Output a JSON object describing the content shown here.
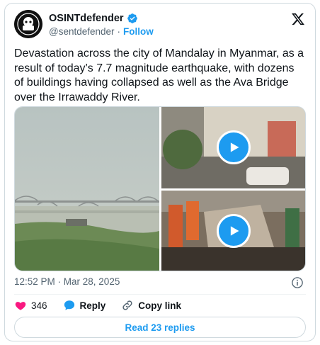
{
  "author": {
    "name": "OSINTdefender",
    "handle": "@sentdefender",
    "separator": "·",
    "follow_label": "Follow"
  },
  "tweet": {
    "text": "Devastation across the city of Mandalay in Myanmar, as a result of today’s 7.7 magnitude earthquake, with dozens of buildings having collapsed as well as the Ava Bridge over the Irrawaddy River.",
    "timestamp": "12:52 PM · Mar 28, 2025"
  },
  "actions": {
    "likes": "346",
    "reply_label": "Reply",
    "copy_link_label": "Copy link"
  },
  "replies_button": "Read 23 replies",
  "colors": {
    "accent": "#1d9bf0",
    "like": "#f91880",
    "text": "#0f1419",
    "muted": "#536471"
  },
  "icons": [
    "verified-badge-icon",
    "x-logo-icon",
    "info-icon",
    "heart-icon",
    "reply-bubble-icon",
    "link-icon",
    "play-icon"
  ]
}
